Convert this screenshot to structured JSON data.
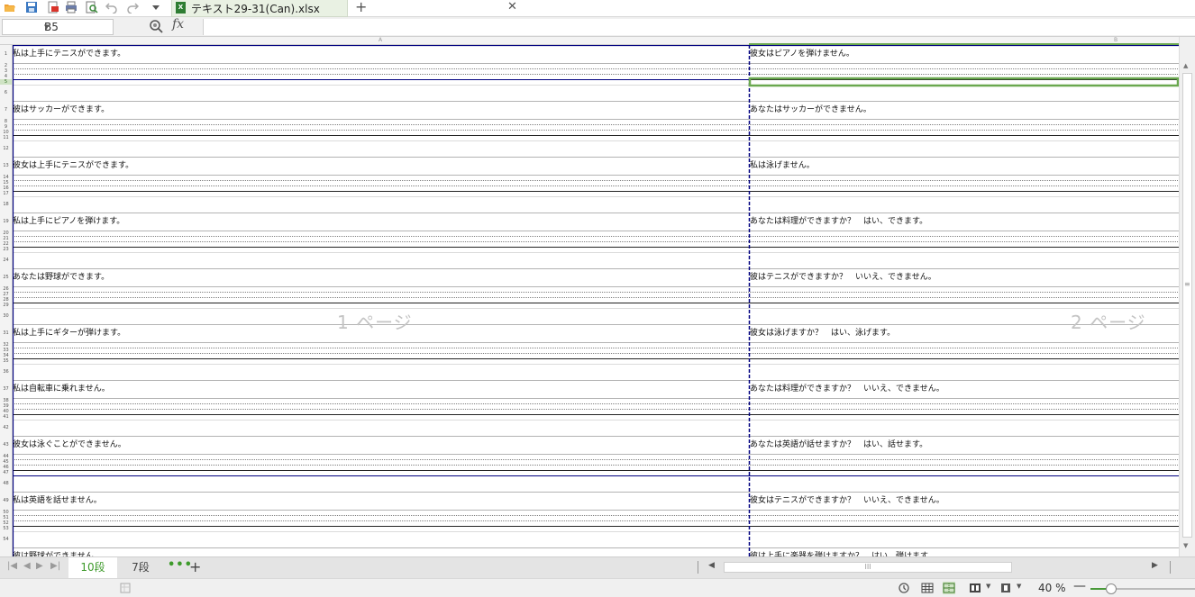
{
  "document": {
    "tab_name": "テキスト29-31(Can).xlsx",
    "file_icon": "excel-file-icon"
  },
  "toolbar": {
    "icons": [
      "open-folder-icon",
      "save-icon",
      "export-pdf-icon",
      "print-icon",
      "print-preview-icon",
      "undo-icon",
      "redo-icon",
      "more-dropdown-icon"
    ]
  },
  "formula_bar": {
    "name_box": "B5",
    "fx": "fx",
    "formula": ""
  },
  "columns": {
    "a": "A",
    "b": "B"
  },
  "rows": {
    "selected": 5,
    "numbers": [
      "1",
      "2",
      "3",
      "4",
      "5",
      "6",
      "7",
      "8",
      "9",
      "10",
      "11",
      "12",
      "13",
      "14",
      "15",
      "16",
      "17",
      "18",
      "19",
      "20",
      "21",
      "22",
      "23",
      "24",
      "25",
      "26",
      "27",
      "28",
      "29",
      "30",
      "31",
      "32",
      "33",
      "34",
      "35",
      "36",
      "37",
      "38",
      "39",
      "40",
      "41",
      "42",
      "43",
      "44",
      "45",
      "46",
      "47",
      "48",
      "49",
      "50",
      "51",
      "52",
      "53",
      "54"
    ]
  },
  "page_watermarks": {
    "page1": "1 ページ",
    "page2": "2 ページ"
  },
  "cells_a": [
    "私は上手にテニスができます。",
    "彼はサッカーができます。",
    "彼女は上手にテニスができます。",
    "私は上手にピアノを弾けます。",
    "あなたは野球ができます。",
    "私は上手にギターが弾けます。",
    "私は自転車に乗れません。",
    "彼女は泳ぐことができません。",
    "私は英語を話せません。",
    "彼は野球ができません。"
  ],
  "cells_b": [
    "彼女はピアノを弾けません。",
    "あなたはサッカーができません。",
    "私は泳げません。",
    "あなたは料理ができますか？　はい、できます。",
    "彼はテニスができますか？　いいえ、できません。",
    "彼女は泳げますか？　はい、泳げます。",
    "あなたは料理ができますか？　いいえ、できません。",
    "あなたは英語が話せますか？　はい、話せます。",
    "彼女はテニスができますか？　いいえ、できません。",
    "彼は上手に楽器を弾けますか？　はい、弾けます。"
  ],
  "sheet_tabs": {
    "tabs": [
      "10段",
      "7段"
    ],
    "active": "10段",
    "more": "•••",
    "add": "+"
  },
  "hscroll": {
    "grip": "III"
  },
  "status": {
    "zoom": "40 %",
    "zoom_fraction": 0.2
  },
  "colors": {
    "accent": "#3d9a2a",
    "selection": "#6aa84f",
    "page_break": "#000080"
  }
}
